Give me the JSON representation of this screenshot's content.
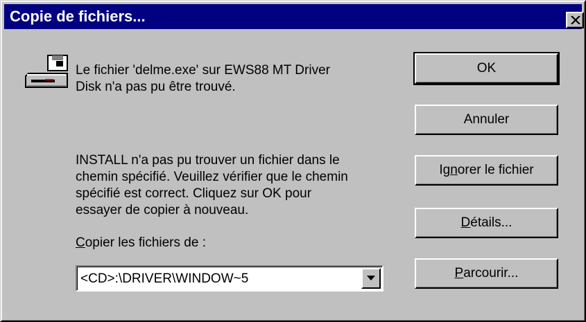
{
  "window": {
    "title": "Copie de fichiers..."
  },
  "message": {
    "error": "Le fichier 'delme.exe' sur EWS88 MT Driver\nDisk n'a pas pu être trouvé.",
    "instructions": "INSTALL n'a pas pu trouver un fichier dans le\nchemin spécifié. Veuillez vérifier que le chemin\nspécifié est correct. Cliquez sur OK pour\nessayer de copier à nouveau.",
    "copy_from_label_accel": "C",
    "copy_from_label_rest": "opier les fichiers de :"
  },
  "copy_from": {
    "value": "<CD>:\\DRIVER\\WINDOW~5"
  },
  "buttons": {
    "ok": "OK",
    "cancel": "Annuler",
    "ignore_pre": "Ig",
    "ignore_accel": "n",
    "ignore_post": "orer le fichier",
    "details_accel": "D",
    "details_post": "étails...",
    "browse_accel": "P",
    "browse_post": "arcourir..."
  },
  "icons": {
    "dialog_icon": "disk-drive-icon",
    "close": "close-icon",
    "dropdown": "chevron-down-icon"
  }
}
